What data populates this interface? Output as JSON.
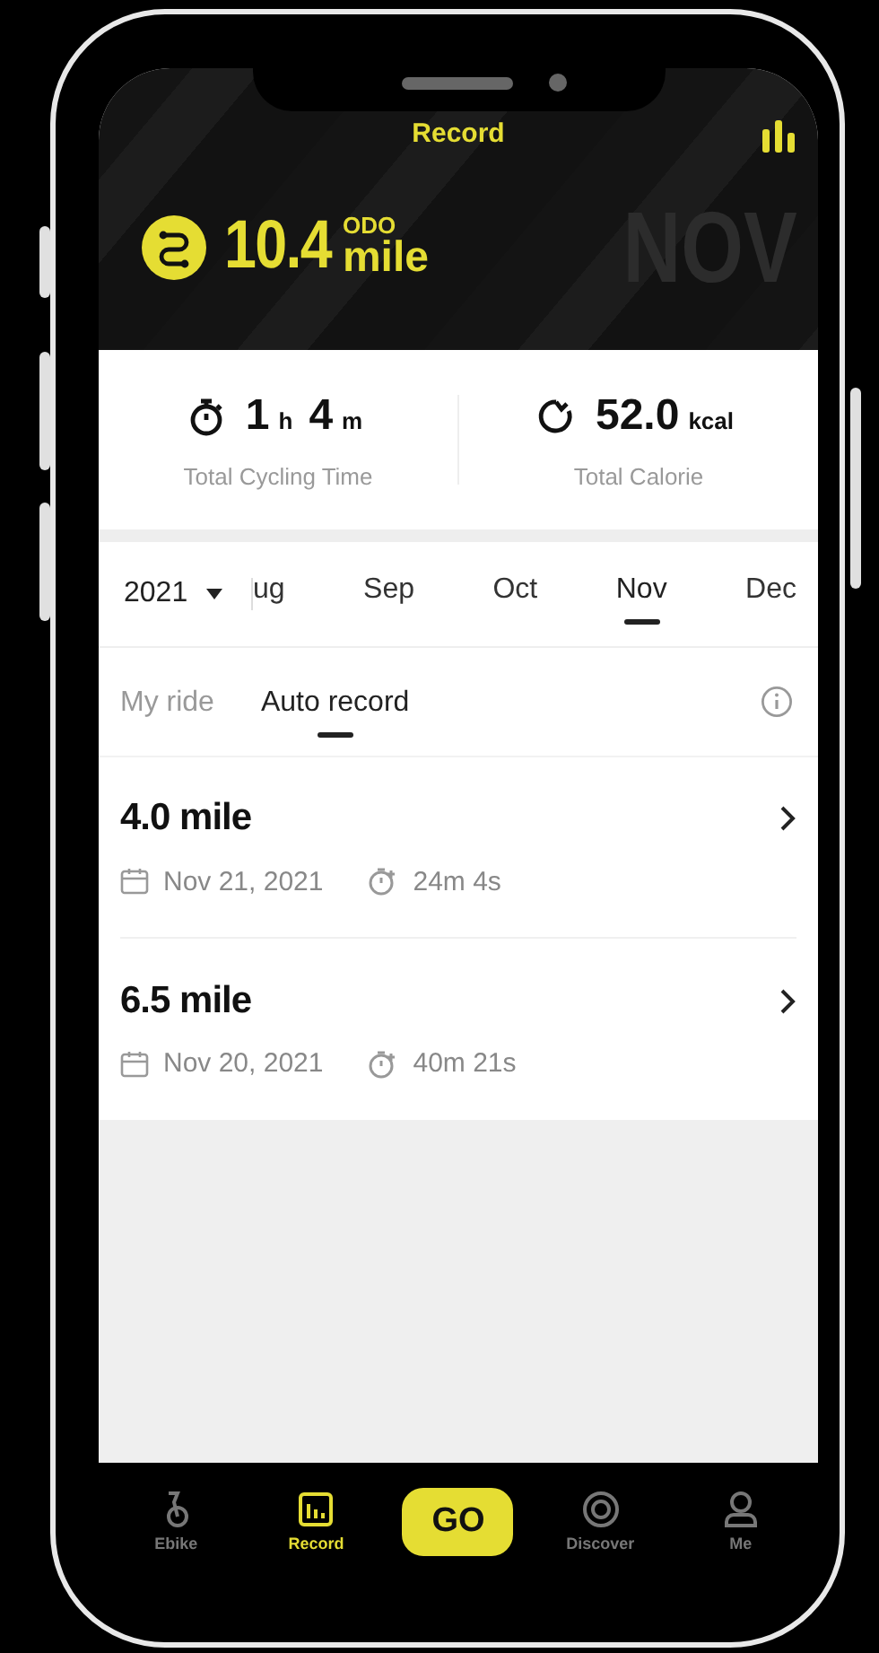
{
  "header": {
    "title": "Record",
    "odometer": {
      "value": "10.4",
      "label": "ODO",
      "unit": "mile"
    },
    "month_watermark": "NOV"
  },
  "stats": [
    {
      "kind": "time",
      "parts": [
        {
          "number": "1",
          "unit": "h"
        },
        {
          "number": "4",
          "unit": "m"
        }
      ],
      "label": "Total Cycling Time"
    },
    {
      "kind": "calorie",
      "parts": [
        {
          "number": "52.0",
          "unit": "kcal"
        }
      ],
      "label": "Total Calorie"
    }
  ],
  "year": "2021",
  "months": [
    {
      "label": "ug",
      "selected": false
    },
    {
      "label": "Sep",
      "selected": false
    },
    {
      "label": "Oct",
      "selected": false
    },
    {
      "label": "Nov",
      "selected": true
    },
    {
      "label": "Dec",
      "selected": false
    }
  ],
  "tabs": [
    {
      "label": "My ride",
      "selected": false
    },
    {
      "label": "Auto record",
      "selected": true
    }
  ],
  "rides": [
    {
      "distance": "4.0 mile",
      "date": "Nov 21, 2021",
      "duration": "24m 4s"
    },
    {
      "distance": "6.5 mile",
      "date": "Nov 20, 2021",
      "duration": "40m 21s"
    }
  ],
  "nav": [
    {
      "kind": "ebike",
      "label": "Ebike",
      "selected": false
    },
    {
      "kind": "record",
      "label": "Record",
      "selected": true
    },
    {
      "kind": "go",
      "label": "GO",
      "selected": false
    },
    {
      "kind": "discover",
      "label": "Discover",
      "selected": false
    },
    {
      "kind": "me",
      "label": "Me",
      "selected": false
    }
  ]
}
